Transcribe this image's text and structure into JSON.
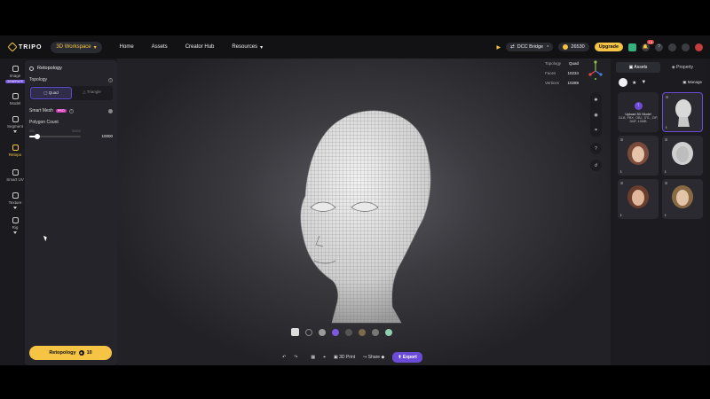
{
  "header": {
    "logo": "TRIPO",
    "workspace": "3D Workspace",
    "nav": [
      "Home",
      "Assets",
      "Creator Hub",
      "Resources"
    ],
    "dcc_bridge": "DCC Bridge",
    "credits": "26530",
    "upgrade": "Upgrade",
    "notifications": "13"
  },
  "rail": {
    "items": [
      {
        "label": "Image",
        "tag": "GENERATE"
      },
      {
        "label": "Model"
      },
      {
        "label": "Segment"
      },
      {
        "label": "Retopo"
      },
      {
        "label": "Smart UV"
      },
      {
        "label": "Texture"
      },
      {
        "label": "Rig"
      }
    ]
  },
  "panel": {
    "title": "Retopology",
    "topology_label": "Topology",
    "modes": [
      "Quad",
      "Triangle"
    ],
    "selected_mode": "Quad",
    "smart_mesh": "Smart Mesh",
    "pro_tag": "PRO",
    "polygon_label": "Polygon Count",
    "slider_min": "500",
    "slider_max": "50000",
    "polygon_value": "10000",
    "slider_fraction": 0.15,
    "button": "Retopology",
    "button_cost": "10"
  },
  "viewport": {
    "stats": [
      {
        "label": "Topology",
        "value": "Quad"
      },
      {
        "label": "Faces",
        "value": "10234"
      },
      {
        "label": "Vertices",
        "value": "10289"
      }
    ],
    "actions": {
      "print": "3D Print",
      "share": "Share",
      "export": "Export"
    },
    "help": "?"
  },
  "assets_panel": {
    "tabs": [
      "Assets",
      "Property"
    ],
    "manage": "Manage",
    "upload_title": "Upload 3D Model",
    "upload_hint": "GLB, FBX, OBJ, STL, ZIP, 3MF, 10MB"
  },
  "colors": {
    "accent": "#f6c445",
    "primary": "#6b4cd8",
    "pro": "#d43ab5"
  }
}
